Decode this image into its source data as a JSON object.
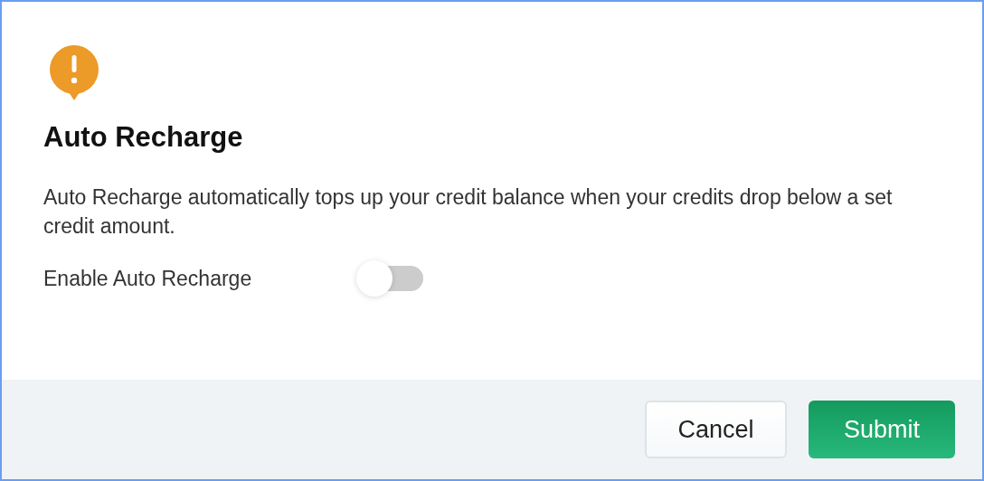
{
  "dialog": {
    "title": "Auto Recharge",
    "description": "Auto Recharge automatically tops up your credit balance when your credits drop below a set credit amount.",
    "toggle": {
      "label": "Enable Auto Recharge",
      "on": false
    },
    "buttons": [
      {
        "label": "Cancel",
        "kind": "secondary"
      },
      {
        "label": "Submit",
        "kind": "primary"
      }
    ]
  }
}
